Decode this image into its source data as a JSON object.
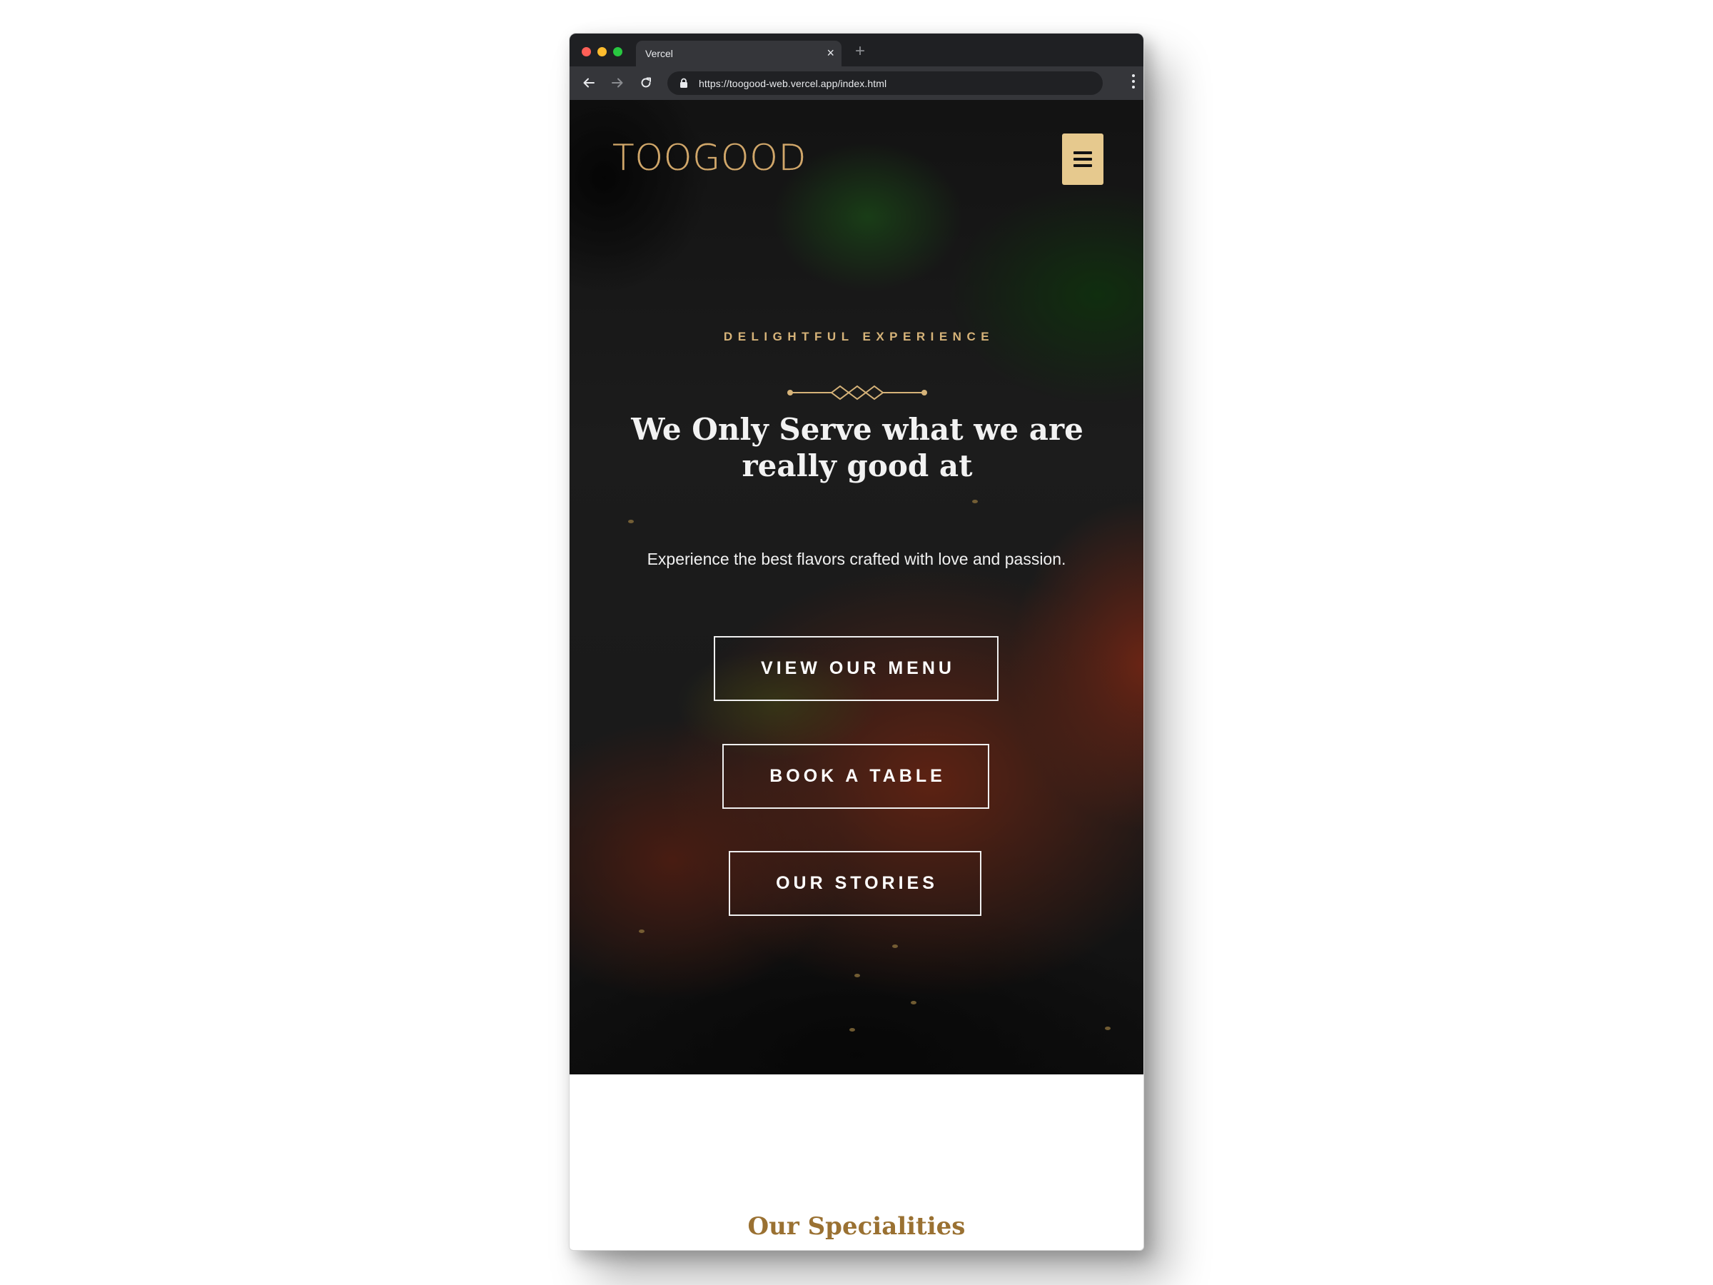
{
  "browser": {
    "tab_title": "Vercel",
    "tab_close": "×",
    "new_tab": "+",
    "url": "https://toogood-web.vercel.app/index.html",
    "traffic_lights": [
      "#ff5f57",
      "#febc2e",
      "#28c840"
    ]
  },
  "header": {
    "logo": "TOOGOOD",
    "menu_icon": "hamburger-menu-icon"
  },
  "hero": {
    "subtitle": "DELIGHTFUL EXPERIENCE",
    "headline": "We Only Serve what we are really good at",
    "tagline": "Experience the best flavors crafted with love and passion.",
    "buttons": {
      "view_menu": "VIEW OUR MENU",
      "book_table": "BOOK A TABLE",
      "our_stories": "OUR STORIES"
    }
  },
  "specialities": {
    "title": "Our Specialities"
  },
  "colors": {
    "gold": "#d1a76a",
    "menu_button": "#e6c98e",
    "section_title": "#9a7132"
  }
}
